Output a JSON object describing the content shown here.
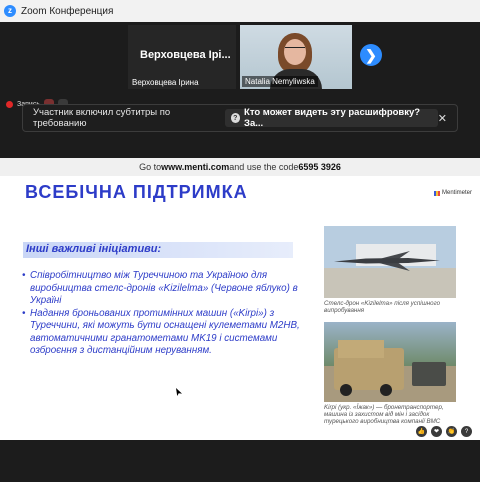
{
  "window": {
    "title": "Zoom Конференция",
    "logo_glyph": "z"
  },
  "participants": [
    {
      "display_name": "Верховцева Ірі...",
      "label": "Верховцева Ірина"
    },
    {
      "label": "Natalia Nemyliwska"
    }
  ],
  "controls": {
    "next_page_icon": "chevron-right-icon",
    "next_glyph": "❯"
  },
  "recording": {
    "label1": "Запись",
    "label2": "",
    "label3": ""
  },
  "caption_banner": {
    "message": "Участник включил субтитры по требованию",
    "link_text": "Кто может видеть эту расшифровку? За...",
    "link_icon_glyph": "?",
    "close_glyph": "✕"
  },
  "slide": {
    "menti_prefix": "Go to ",
    "menti_url": "www.menti.com",
    "menti_mid": " and use the code ",
    "menti_code": "6595 3926",
    "menti_brand": "Mentimeter",
    "title": "ВСЕБІЧНА ПІДТРИМКА",
    "subhead": "Інші важливі ініціативи:",
    "bullets": [
      "Співробітництво між Туреччиною та Україною для виробництва стелс-дронів «Kizilelma» (Червоне яблуко) в Україні",
      "Надання броньованих протимінних машин («Kirpi») з Туреччини, які можуть бути оснащені кулеметами M2HB, автоматичними гранатометами MK19 і системами озброєння з дистанційним неруванням."
    ],
    "caption1": "Стелс-дрон «Kizilelma» після успішного випробування",
    "caption2": "Kirpi (укр. «Їжак») — бронетранспортер, машина із захистом від мін і засідок турецького виробництва компанії BMC"
  },
  "reactions": [
    "👍",
    "❤",
    "👏",
    "?"
  ],
  "colors": {
    "accent": "#2d3cc8",
    "zoom_blue": "#2d8cff",
    "rec_red": "#e02828"
  }
}
